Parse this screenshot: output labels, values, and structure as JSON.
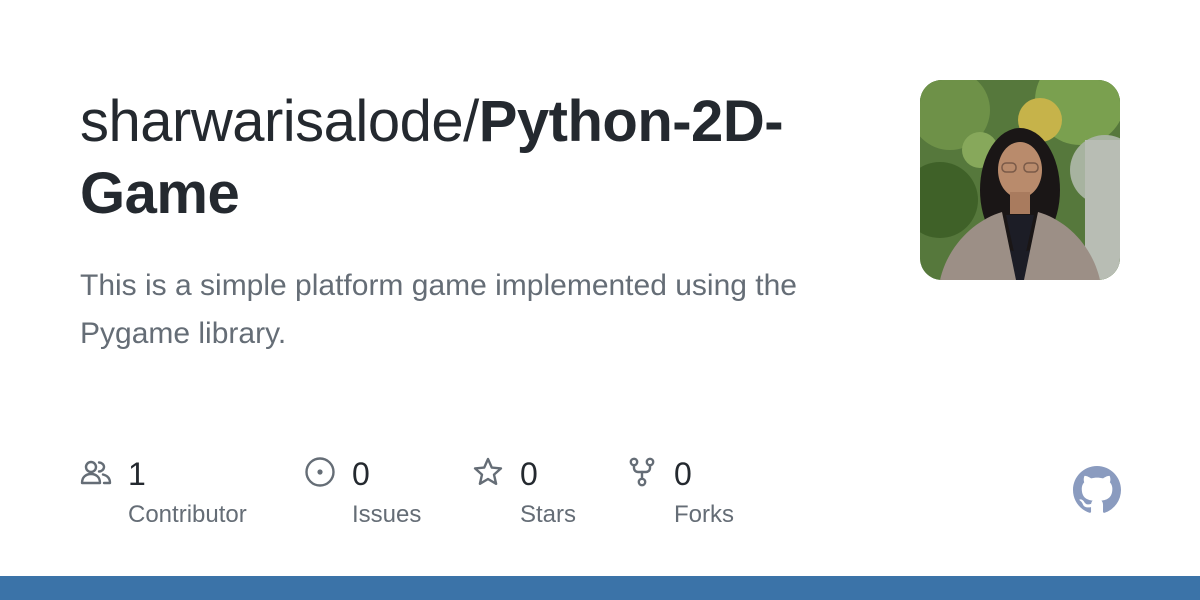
{
  "repo": {
    "owner": "sharwarisalode/",
    "name": "Python-2D-Game",
    "description": "This is a simple platform game implemented using the Pygame library."
  },
  "stats": {
    "contributors": {
      "count": "1",
      "label": "Contributor",
      "icon": "people-icon"
    },
    "issues": {
      "count": "0",
      "label": "Issues",
      "icon": "issue-opened-icon"
    },
    "stars": {
      "count": "0",
      "label": "Stars",
      "icon": "star-icon"
    },
    "forks": {
      "count": "0",
      "label": "Forks",
      "icon": "repo-forked-icon"
    }
  },
  "brand": {
    "logo": "github-mark-icon",
    "bar_color": "#3b73a8",
    "logo_color": "#8a9bbf",
    "icon_color": "#656d76"
  }
}
